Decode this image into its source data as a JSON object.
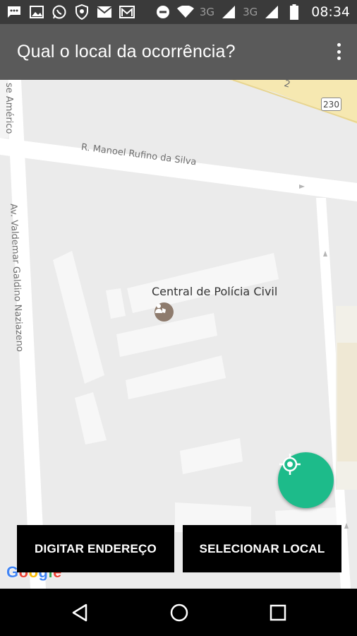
{
  "status_bar": {
    "icons": [
      "chat-icon",
      "image-icon",
      "whatsapp-icon",
      "shield-icon",
      "mail-icon",
      "gmail-icon",
      "do-not-disturb-icon",
      "wifi-icon",
      "signal-icon",
      "signal-icon",
      "battery-icon"
    ],
    "network_1": "3G",
    "network_2": "3G",
    "time": "08:34"
  },
  "app_bar": {
    "title": "Qual o local da ocorrência?",
    "overflow_icon": "more-vert-icon"
  },
  "map": {
    "streets": {
      "top_left_partial": "se Américo",
      "top_road": "R. Manoel Rufino da Silva",
      "left_avenue": "Av. Valdemar Galdino Naziazeno"
    },
    "road_shield": "230",
    "top_right_partial": "2",
    "poi": {
      "name": "Central de Polícia Civil",
      "icon": "police-icon"
    },
    "colors": {
      "background": "#ebebeb",
      "road": "#ffffff",
      "building": "#f7f7f7",
      "highway": "#f6e8b1",
      "locate_button": "#1dbb8a"
    },
    "locate_icon": "my-location-icon",
    "attribution": "Google"
  },
  "actions": {
    "type_address": "DIGITAR ENDEREÇO",
    "select_location": "SELECIONAR LOCAL"
  },
  "nav_bar": {
    "back_icon": "back-icon",
    "home_icon": "home-icon",
    "recents_icon": "recents-icon"
  }
}
